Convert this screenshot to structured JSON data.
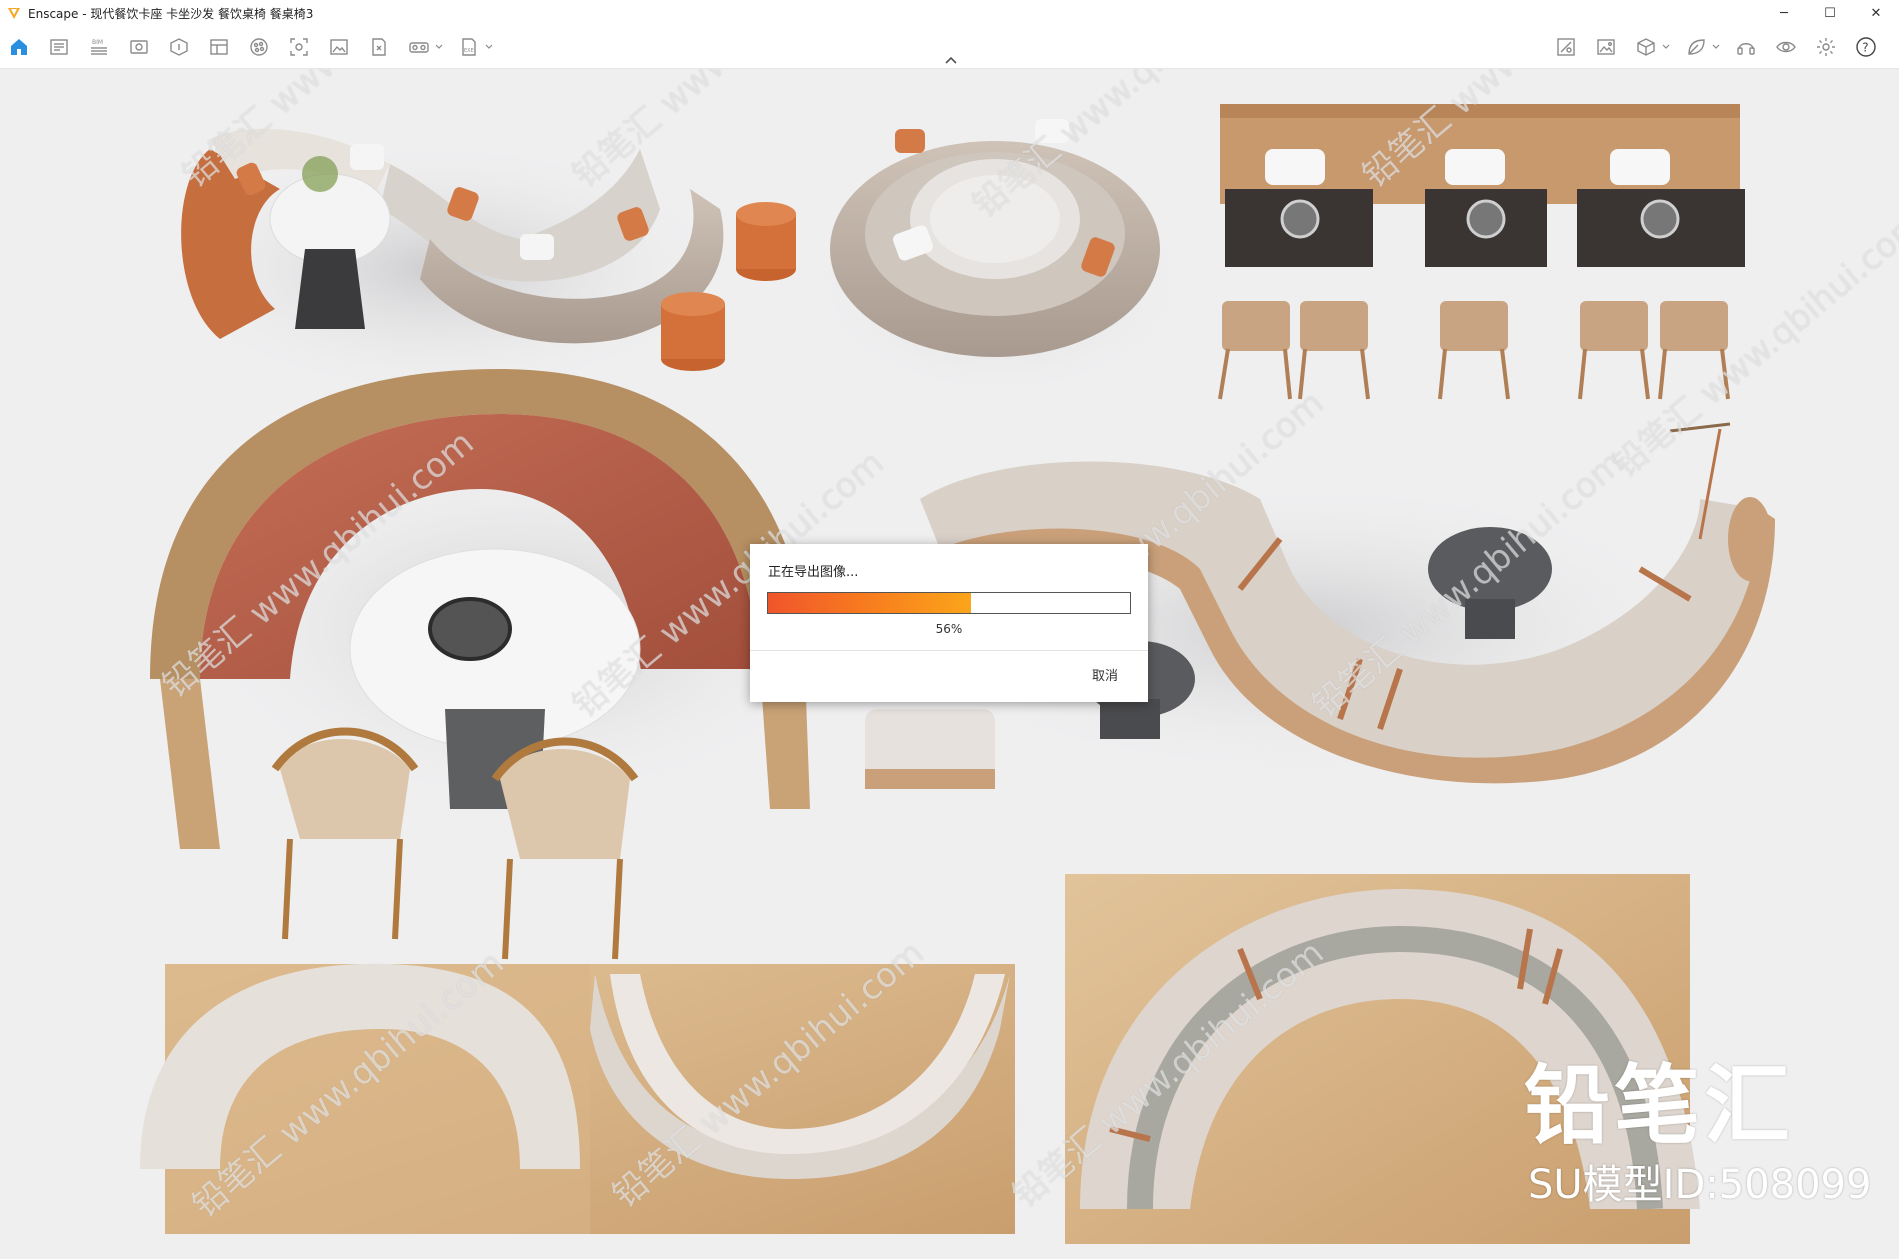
{
  "window": {
    "title": "Enscape - 现代餐饮卡座 卡坐沙发 餐饮桌椅 餐桌椅3",
    "controls": [
      "─",
      "☐",
      "✕"
    ]
  },
  "toolbar": {
    "left_icons": [
      "home-icon",
      "batch-render-icon",
      "bim-icon",
      "views-icon",
      "asset-library-icon",
      "material-editor-icon",
      "atmosphere-icon",
      "capture-icon",
      "screenshot-icon",
      "export-file-icon",
      "vr-headset-icon",
      "exe-export-icon"
    ],
    "right_icons": [
      "asset-placement-icon",
      "image-gallery-icon",
      "cube-view-icon",
      "leaf-icon",
      "headset-icon",
      "eye-icon",
      "settings-icon",
      "help-icon"
    ],
    "bim_label": "BIM",
    "exe_label": "EXE",
    "help_label": "?"
  },
  "dialog": {
    "title": "正在导出图像...",
    "progress": 0.56,
    "percent_label": "56%",
    "cancel_label": "取消"
  },
  "watermark": {
    "brand": "铅笔汇",
    "model_id": "SU模型ID:508099",
    "diagonal_text": "铅笔汇 www.qbihui.com"
  },
  "colors": {
    "accent_orange": "#f7791f",
    "progress_start": "#f0552b",
    "progress_end": "#fba51a",
    "app_logo": "#f5a623"
  }
}
